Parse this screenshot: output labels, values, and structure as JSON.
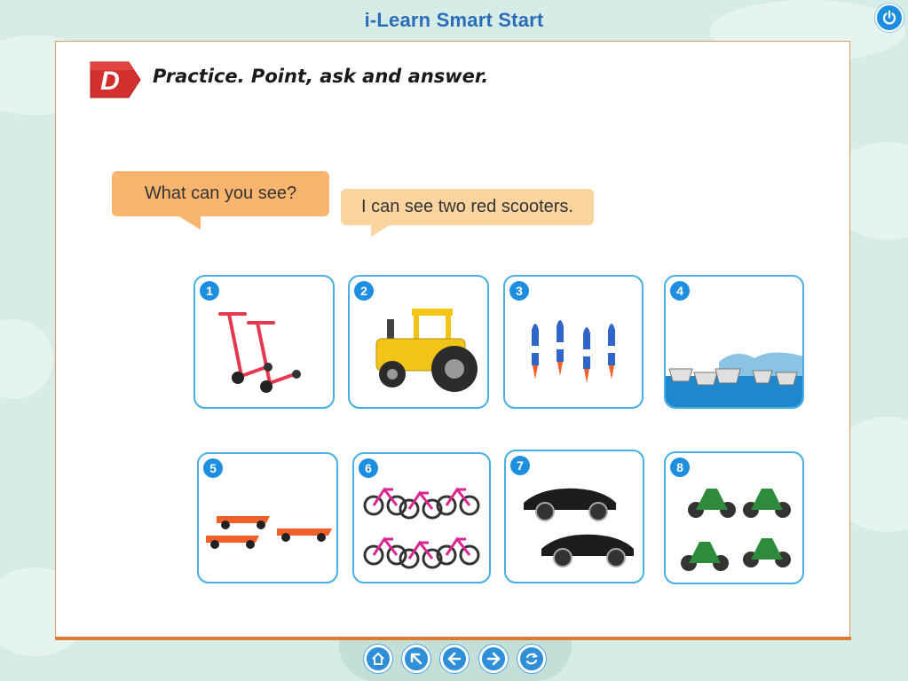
{
  "app": {
    "title": "i-Learn Smart Start"
  },
  "exercise": {
    "badge_letter": "D",
    "instruction": "Practice. Point, ask and answer."
  },
  "dialogue": {
    "question": "What can you see?",
    "answer": "I can see two red scooters."
  },
  "cards": [
    {
      "number": "1",
      "picture": "two-red-scooters"
    },
    {
      "number": "2",
      "picture": "yellow-tractor"
    },
    {
      "number": "3",
      "picture": "four-rockets"
    },
    {
      "number": "4",
      "picture": "five-ships"
    },
    {
      "number": "5",
      "picture": "three-race-cars"
    },
    {
      "number": "6",
      "picture": "six-pink-bikes"
    },
    {
      "number": "7",
      "picture": "two-black-cars"
    },
    {
      "number": "8",
      "picture": "four-green-motorbikes"
    }
  ],
  "nav": [
    "home-icon",
    "back-to-start-icon",
    "previous-icon",
    "next-icon",
    "replay-icon"
  ],
  "colors": {
    "title_blue": "#2a6cb8",
    "badge_red": "#d32f2f",
    "card_border": "#46b0e3",
    "number_blue": "#1e8fe0",
    "bubble_orange": "#f9b56e",
    "bubble_light": "#fcd4a0",
    "panel_border": "#e07a2e"
  }
}
